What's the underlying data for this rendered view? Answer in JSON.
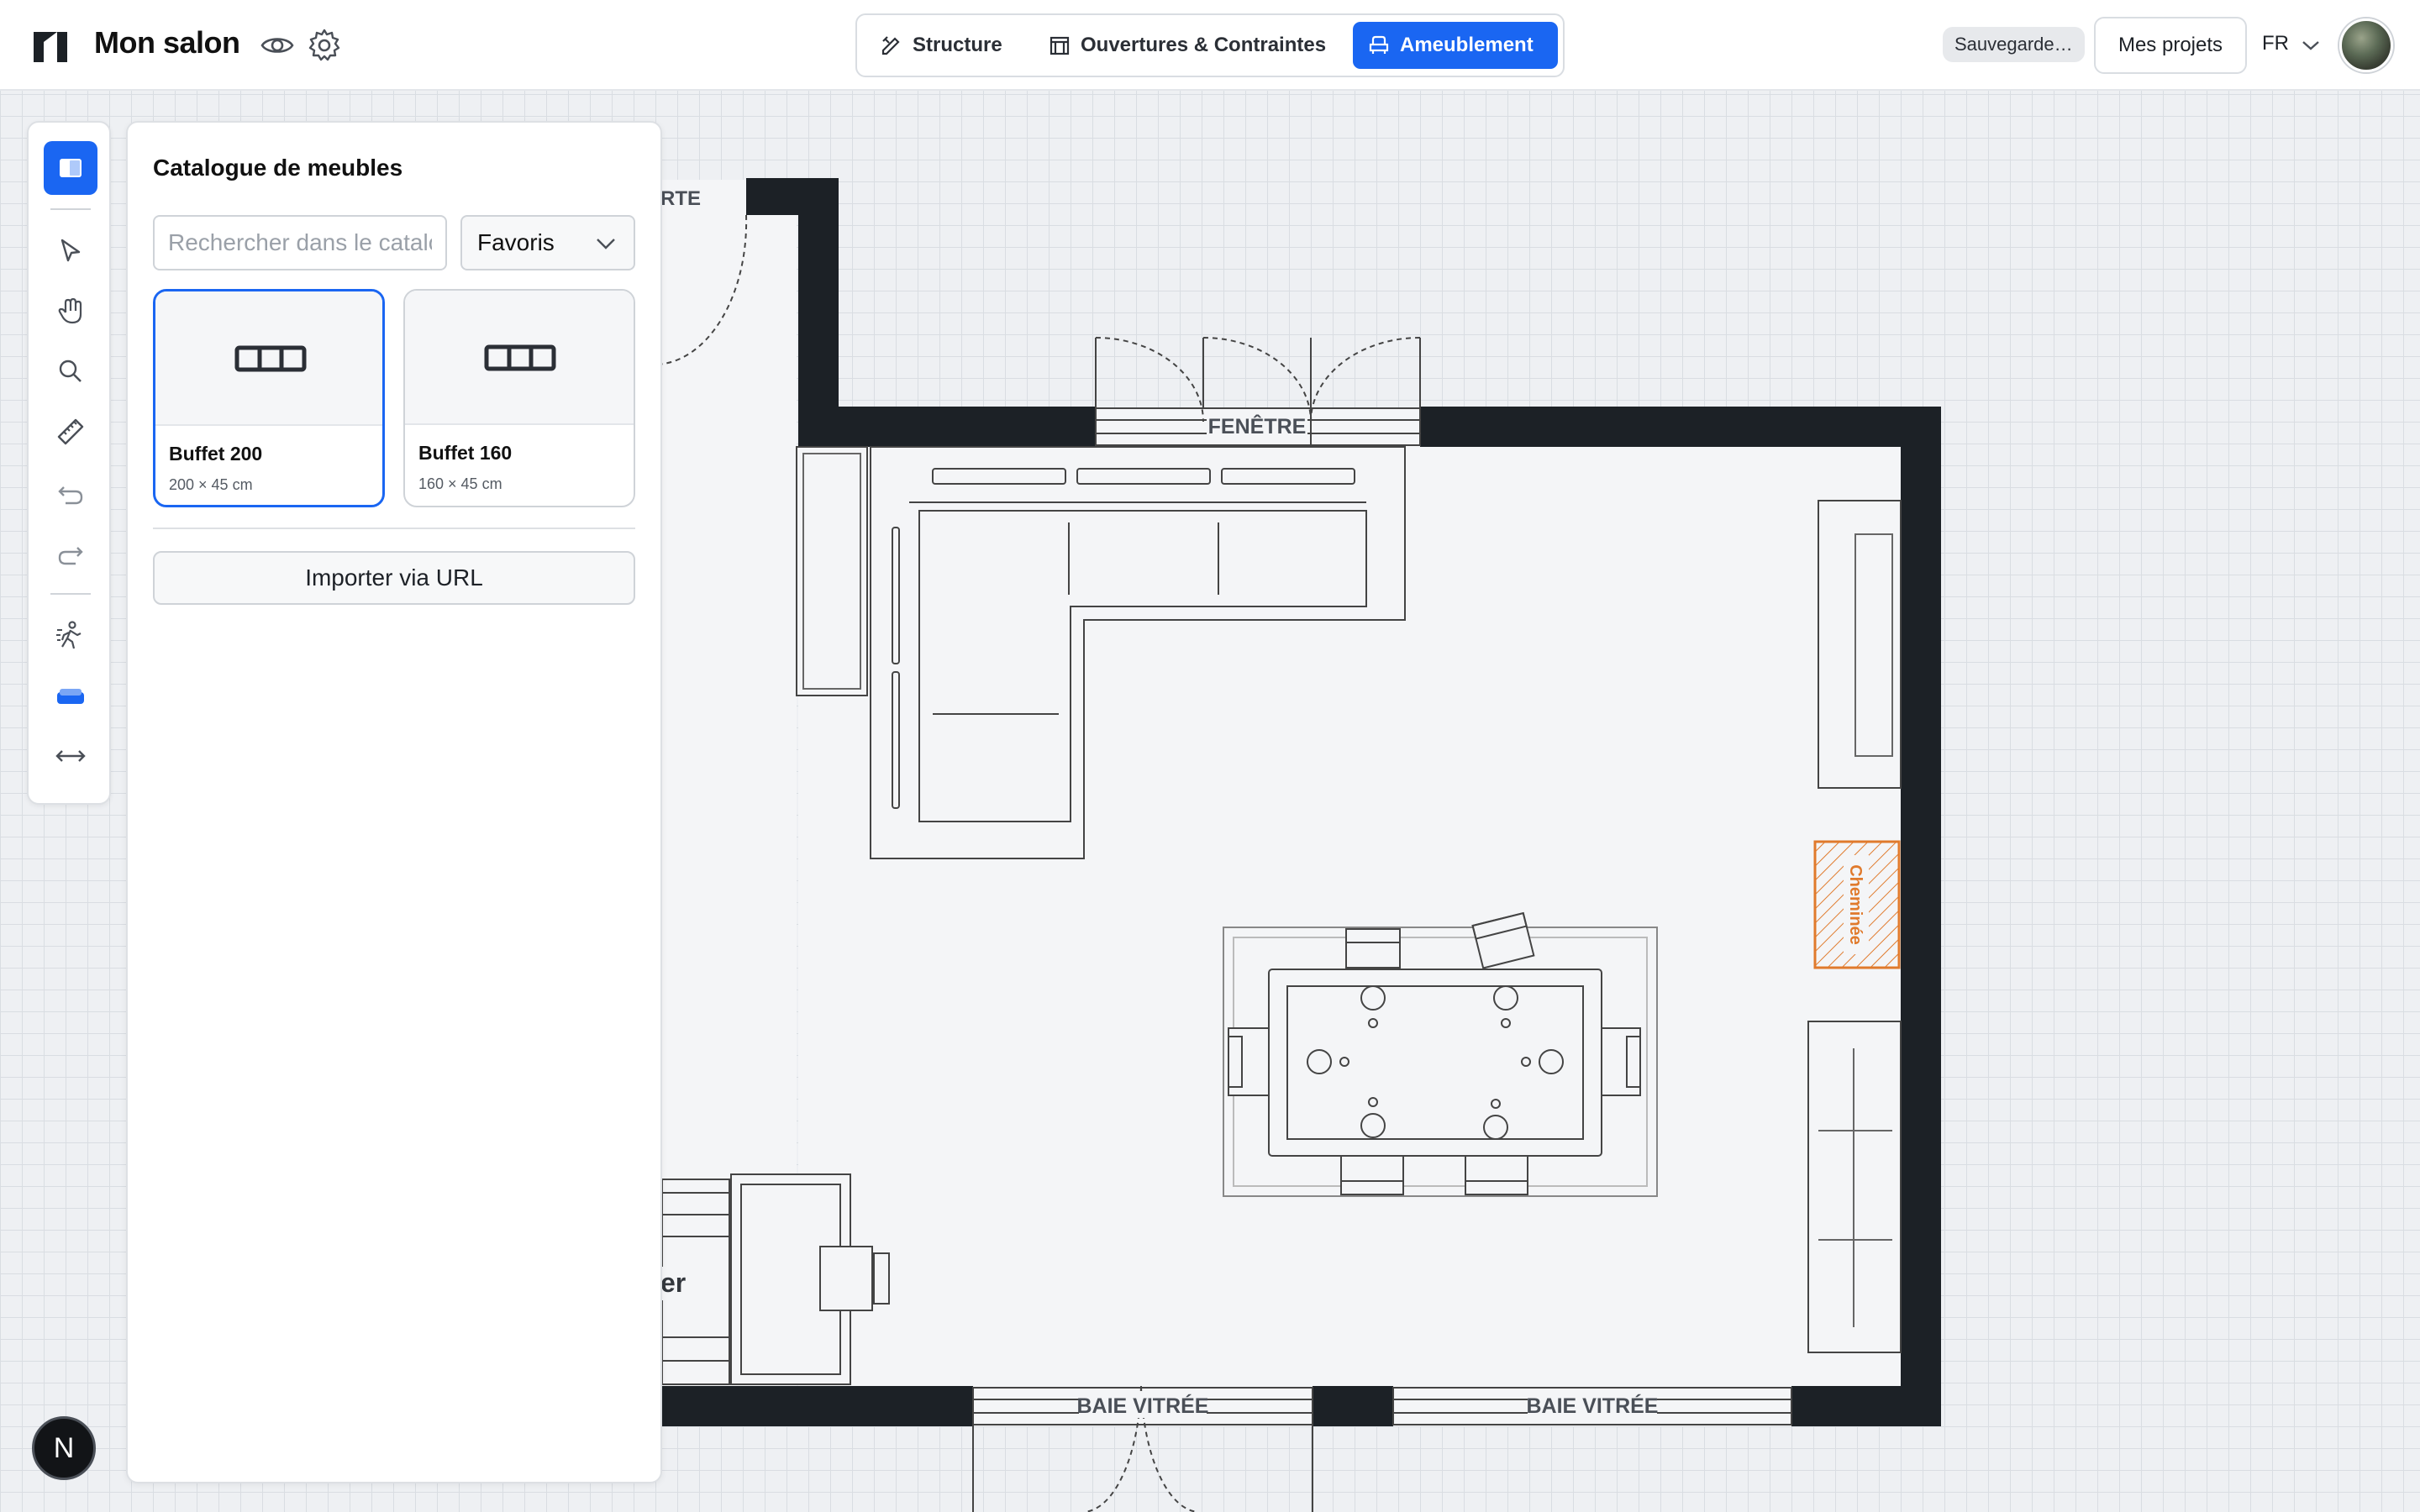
{
  "app": {
    "title": "Mon salon"
  },
  "modes": [
    {
      "label": "Structure",
      "icon": "ruler-pencil-icon",
      "active": false
    },
    {
      "label": "Ouvertures & Contraintes",
      "icon": "window-frame-icon",
      "active": false
    },
    {
      "label": "Ameublement",
      "icon": "armchair-icon",
      "active": true
    }
  ],
  "header": {
    "saving_label": "Sauvegarde…",
    "projects_label": "Mes projets",
    "language": "FR"
  },
  "colors": {
    "accent": "#1a66f2",
    "wall": "#1c2126",
    "fireplace": "#e07a2c"
  },
  "toolbar": {
    "tools": [
      "catalogue-icon",
      "cursor-icon",
      "hand-icon",
      "zoom-icon",
      "ruler-icon",
      "undo-icon",
      "redo-icon",
      "walk-icon",
      "sofa-icon",
      "dimension-icon"
    ]
  },
  "catalogue": {
    "title": "Catalogue de meubles",
    "search_placeholder": "Rechercher dans le catalogue",
    "filter_value": "Favoris",
    "items": [
      {
        "name": "Buffet 200",
        "dimensions": "200 × 45 cm",
        "selected": true
      },
      {
        "name": "Buffet 160",
        "dimensions": "160 × 45 cm",
        "selected": false
      }
    ],
    "import_label": "Importer via URL"
  },
  "plan": {
    "labels": {
      "door": "RTE",
      "window": "FENÊTRE",
      "bay1": "BAIE VITRÉE",
      "bay2": "BAIE VITRÉE",
      "fireplace": "Cheminée",
      "room_partial": "er"
    }
  },
  "badge": {
    "letter": "N"
  }
}
